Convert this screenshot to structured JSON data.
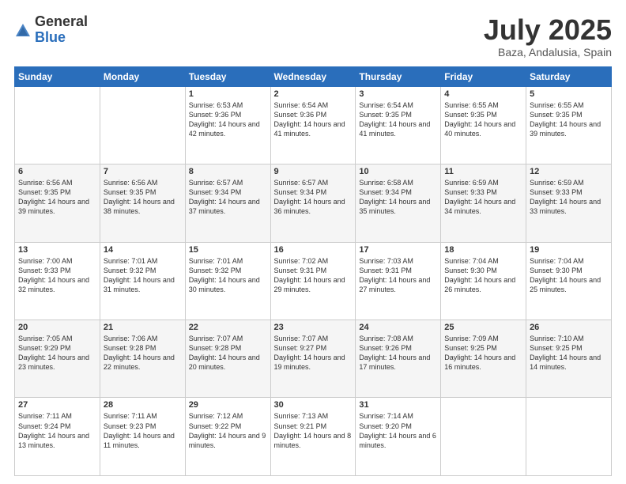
{
  "header": {
    "logo_general": "General",
    "logo_blue": "Blue",
    "month_title": "July 2025",
    "location": "Baza, Andalusia, Spain"
  },
  "weekdays": [
    "Sunday",
    "Monday",
    "Tuesday",
    "Wednesday",
    "Thursday",
    "Friday",
    "Saturday"
  ],
  "weeks": [
    [
      {
        "day": "",
        "sunrise": "",
        "sunset": "",
        "daylight": ""
      },
      {
        "day": "",
        "sunrise": "",
        "sunset": "",
        "daylight": ""
      },
      {
        "day": "1",
        "sunrise": "Sunrise: 6:53 AM",
        "sunset": "Sunset: 9:36 PM",
        "daylight": "Daylight: 14 hours and 42 minutes."
      },
      {
        "day": "2",
        "sunrise": "Sunrise: 6:54 AM",
        "sunset": "Sunset: 9:36 PM",
        "daylight": "Daylight: 14 hours and 41 minutes."
      },
      {
        "day": "3",
        "sunrise": "Sunrise: 6:54 AM",
        "sunset": "Sunset: 9:35 PM",
        "daylight": "Daylight: 14 hours and 41 minutes."
      },
      {
        "day": "4",
        "sunrise": "Sunrise: 6:55 AM",
        "sunset": "Sunset: 9:35 PM",
        "daylight": "Daylight: 14 hours and 40 minutes."
      },
      {
        "day": "5",
        "sunrise": "Sunrise: 6:55 AM",
        "sunset": "Sunset: 9:35 PM",
        "daylight": "Daylight: 14 hours and 39 minutes."
      }
    ],
    [
      {
        "day": "6",
        "sunrise": "Sunrise: 6:56 AM",
        "sunset": "Sunset: 9:35 PM",
        "daylight": "Daylight: 14 hours and 39 minutes."
      },
      {
        "day": "7",
        "sunrise": "Sunrise: 6:56 AM",
        "sunset": "Sunset: 9:35 PM",
        "daylight": "Daylight: 14 hours and 38 minutes."
      },
      {
        "day": "8",
        "sunrise": "Sunrise: 6:57 AM",
        "sunset": "Sunset: 9:34 PM",
        "daylight": "Daylight: 14 hours and 37 minutes."
      },
      {
        "day": "9",
        "sunrise": "Sunrise: 6:57 AM",
        "sunset": "Sunset: 9:34 PM",
        "daylight": "Daylight: 14 hours and 36 minutes."
      },
      {
        "day": "10",
        "sunrise": "Sunrise: 6:58 AM",
        "sunset": "Sunset: 9:34 PM",
        "daylight": "Daylight: 14 hours and 35 minutes."
      },
      {
        "day": "11",
        "sunrise": "Sunrise: 6:59 AM",
        "sunset": "Sunset: 9:33 PM",
        "daylight": "Daylight: 14 hours and 34 minutes."
      },
      {
        "day": "12",
        "sunrise": "Sunrise: 6:59 AM",
        "sunset": "Sunset: 9:33 PM",
        "daylight": "Daylight: 14 hours and 33 minutes."
      }
    ],
    [
      {
        "day": "13",
        "sunrise": "Sunrise: 7:00 AM",
        "sunset": "Sunset: 9:33 PM",
        "daylight": "Daylight: 14 hours and 32 minutes."
      },
      {
        "day": "14",
        "sunrise": "Sunrise: 7:01 AM",
        "sunset": "Sunset: 9:32 PM",
        "daylight": "Daylight: 14 hours and 31 minutes."
      },
      {
        "day": "15",
        "sunrise": "Sunrise: 7:01 AM",
        "sunset": "Sunset: 9:32 PM",
        "daylight": "Daylight: 14 hours and 30 minutes."
      },
      {
        "day": "16",
        "sunrise": "Sunrise: 7:02 AM",
        "sunset": "Sunset: 9:31 PM",
        "daylight": "Daylight: 14 hours and 29 minutes."
      },
      {
        "day": "17",
        "sunrise": "Sunrise: 7:03 AM",
        "sunset": "Sunset: 9:31 PM",
        "daylight": "Daylight: 14 hours and 27 minutes."
      },
      {
        "day": "18",
        "sunrise": "Sunrise: 7:04 AM",
        "sunset": "Sunset: 9:30 PM",
        "daylight": "Daylight: 14 hours and 26 minutes."
      },
      {
        "day": "19",
        "sunrise": "Sunrise: 7:04 AM",
        "sunset": "Sunset: 9:30 PM",
        "daylight": "Daylight: 14 hours and 25 minutes."
      }
    ],
    [
      {
        "day": "20",
        "sunrise": "Sunrise: 7:05 AM",
        "sunset": "Sunset: 9:29 PM",
        "daylight": "Daylight: 14 hours and 23 minutes."
      },
      {
        "day": "21",
        "sunrise": "Sunrise: 7:06 AM",
        "sunset": "Sunset: 9:28 PM",
        "daylight": "Daylight: 14 hours and 22 minutes."
      },
      {
        "day": "22",
        "sunrise": "Sunrise: 7:07 AM",
        "sunset": "Sunset: 9:28 PM",
        "daylight": "Daylight: 14 hours and 20 minutes."
      },
      {
        "day": "23",
        "sunrise": "Sunrise: 7:07 AM",
        "sunset": "Sunset: 9:27 PM",
        "daylight": "Daylight: 14 hours and 19 minutes."
      },
      {
        "day": "24",
        "sunrise": "Sunrise: 7:08 AM",
        "sunset": "Sunset: 9:26 PM",
        "daylight": "Daylight: 14 hours and 17 minutes."
      },
      {
        "day": "25",
        "sunrise": "Sunrise: 7:09 AM",
        "sunset": "Sunset: 9:25 PM",
        "daylight": "Daylight: 14 hours and 16 minutes."
      },
      {
        "day": "26",
        "sunrise": "Sunrise: 7:10 AM",
        "sunset": "Sunset: 9:25 PM",
        "daylight": "Daylight: 14 hours and 14 minutes."
      }
    ],
    [
      {
        "day": "27",
        "sunrise": "Sunrise: 7:11 AM",
        "sunset": "Sunset: 9:24 PM",
        "daylight": "Daylight: 14 hours and 13 minutes."
      },
      {
        "day": "28",
        "sunrise": "Sunrise: 7:11 AM",
        "sunset": "Sunset: 9:23 PM",
        "daylight": "Daylight: 14 hours and 11 minutes."
      },
      {
        "day": "29",
        "sunrise": "Sunrise: 7:12 AM",
        "sunset": "Sunset: 9:22 PM",
        "daylight": "Daylight: 14 hours and 9 minutes."
      },
      {
        "day": "30",
        "sunrise": "Sunrise: 7:13 AM",
        "sunset": "Sunset: 9:21 PM",
        "daylight": "Daylight: 14 hours and 8 minutes."
      },
      {
        "day": "31",
        "sunrise": "Sunrise: 7:14 AM",
        "sunset": "Sunset: 9:20 PM",
        "daylight": "Daylight: 14 hours and 6 minutes."
      },
      {
        "day": "",
        "sunrise": "",
        "sunset": "",
        "daylight": ""
      },
      {
        "day": "",
        "sunrise": "",
        "sunset": "",
        "daylight": ""
      }
    ]
  ]
}
